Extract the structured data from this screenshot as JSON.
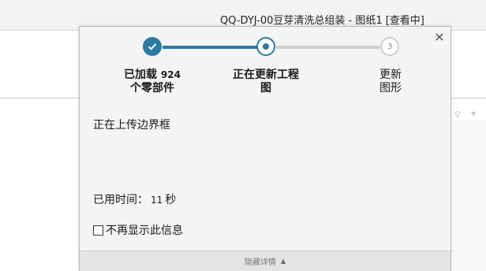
{
  "window": {
    "title": "QQ-DYJ-00豆芽清洗总组装 - 图纸1 [查看中]"
  },
  "dialog": {
    "close_icon": "×",
    "steps": [
      {
        "line1": "已加载",
        "line1_num": "924",
        "line2": "个零部件",
        "state": "complete",
        "icon": "check-icon"
      },
      {
        "line1": "正在更新工程",
        "line2": "图",
        "state": "active"
      },
      {
        "number": "3",
        "line1": "更新",
        "line2": "图形",
        "state": "pending"
      }
    ],
    "status_message": "正在上传边界框",
    "elapsed": {
      "label": "已用时间：",
      "value": "11",
      "unit": "秒"
    },
    "dont_show_label": "不再显示此信息",
    "dont_show_checked": false,
    "footer_label": "隐藏详情",
    "footer_icon": "collapse-up-icon",
    "colors": {
      "accent": "#2a7aa3",
      "pending": "#cfcfcf"
    }
  }
}
